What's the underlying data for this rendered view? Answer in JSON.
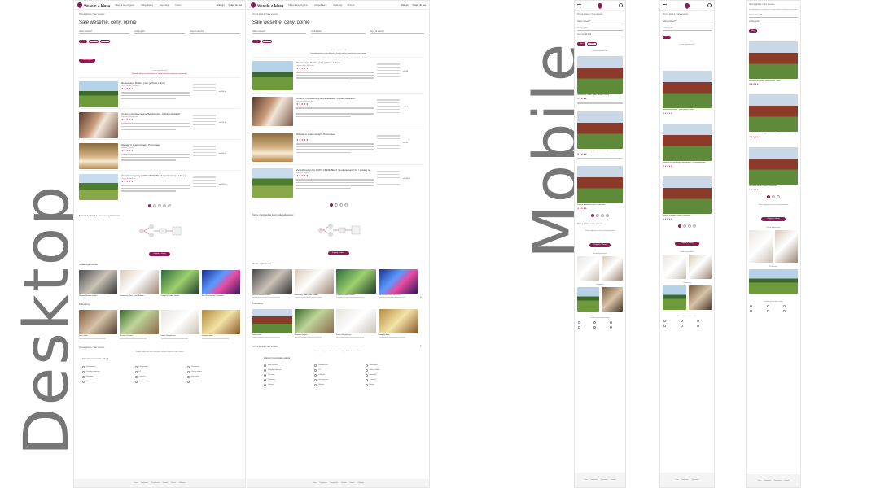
{
  "labels": {
    "desktop": "Desktop",
    "mobile": "Mobile"
  },
  "colors": {
    "brand": "#8a1a52",
    "stars": "#c4145a",
    "label": "#777777"
  },
  "site": {
    "logo_text": "Wesele z klasą",
    "nav": [
      "Miejsca na przyjęcie",
      "Usługodawcy",
      "Inspiracje",
      "Forum"
    ],
    "login": "Zaloguj",
    "join": "Dołącz do nas"
  },
  "breadcrumb": "Strona główna / Sale weselne",
  "page_title": "Sale weselne, ceny, opinie",
  "filters": [
    "Gdzie szukasz?",
    "Liczba gości",
    "Cena za talerzyk"
  ],
  "chips": [
    "Filtry",
    "Ogród",
    "Nocleg"
  ],
  "search_button": "Pokaż wyniki",
  "results_count": "Liczba wyników: 84",
  "info_text": "Sprawdź ofertę sal weselnych w Twojej okolicy i porównaj ceny przyjęć",
  "listings": [
    {
      "title": "Restauracja Rodło - pole golfowe Lubuty",
      "sub": "Lubuty, okolice Warszawy",
      "stars": "★★★★★",
      "price": "od 180 zł",
      "more": "Zobacz więcej"
    },
    {
      "title": "Centrum Konferencyjne Bankietowe „U Dobrowolskich”",
      "sub": "Warszawa, Mazowieckie",
      "stars": "★★★★★",
      "price": "od 220 zł",
      "more": "Zobacz więcej"
    },
    {
      "title": "Wesele w Hotelu Księże Pomorskie",
      "sub": "Gdańsk, Pomorskie",
      "stars": "★★★★★",
      "price": "od 200 zł",
      "more": "Zobacz więcej"
    },
    {
      "title": "Zespół muzyczny CAPO NERE BEAT / konferansjer / DJ / pokazy taneczne",
      "sub": "Kraków, Małopolskie",
      "stars": "★★★★★",
      "price": "od 3500 zł",
      "more": "Zobacz więcej"
    }
  ],
  "pages": [
    "1",
    "2",
    "3",
    "4",
    "5"
  ],
  "how_title": "Może zapytasz w sieci usługodawców",
  "how_button": "Zapytaj o ofertę",
  "news_title": "Nowe ogłoszenia",
  "news": [
    {
      "t": "Muzyka Jazzowa Kraków"
    },
    {
      "t": "Restauracja Złota Jesień Świecie"
    },
    {
      "t": "Fotografia Ślubna Natalia"
    },
    {
      "t": "Sala Weselna Stara Garbarnia"
    }
  ],
  "promo_title": "Polecamy",
  "promo": [
    {
      "t": "Sala Loretto"
    },
    {
      "t": "Wesele w Dworze"
    },
    {
      "t": "Studio Fotograficzne"
    },
    {
      "t": "Fotografia Anna"
    }
  ],
  "bottom_breadcrumb": "Strona główna / Sale weselne",
  "bottom_info": "Znajdź najlepsze sale weselne i usługi ślubne w całej Polsce",
  "services_title": "Zobacz pozostałe usługi",
  "services": [
    "Sale weselne",
    "Fotografowie",
    "Kamerzyści",
    "Zespoły muzyczne",
    "DJ",
    "Suknie ślubne",
    "Garnitury",
    "Obrączki",
    "Florystyka",
    "Dekoracje",
    "Tort weselny",
    "Transport",
    "Noclegi",
    "Makijaż",
    "Fryzjer"
  ],
  "footer": [
    "Onas",
    "Regulamin",
    "Prywatność",
    "Kontakt",
    "Pomoc",
    "Reklama"
  ],
  "mobile_count": "Liczba wyników: 84",
  "mobile_button": "Zapytaj o ofertę"
}
